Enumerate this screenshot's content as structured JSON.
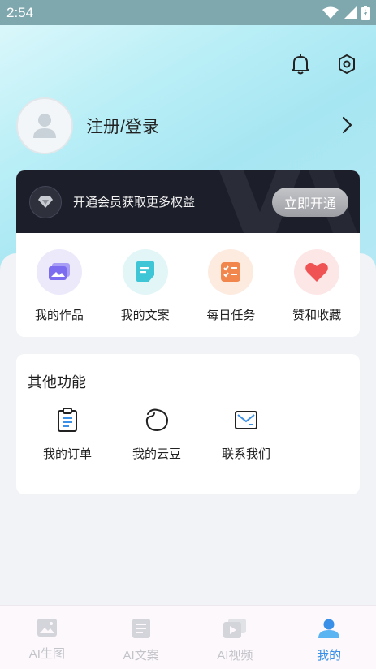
{
  "status_bar": {
    "time": "2:54"
  },
  "profile": {
    "login_label": "注册/登录"
  },
  "vip": {
    "text": "开通会员获取更多权益",
    "button_label": "立即开通"
  },
  "quick_actions": [
    {
      "label": "我的作品",
      "icon": "gallery-icon",
      "bg": "#ece9fb",
      "color": "#7b6cf0"
    },
    {
      "label": "我的文案",
      "icon": "document-icon",
      "bg": "#e2f6f8",
      "color": "#3ec6d6"
    },
    {
      "label": "每日任务",
      "icon": "task-list-icon",
      "bg": "#fdebe0",
      "color": "#f2874d"
    },
    {
      "label": "赞和收藏",
      "icon": "heart-icon",
      "bg": "#fde6e6",
      "color": "#f05353"
    }
  ],
  "other": {
    "title": "其他功能",
    "items": [
      {
        "label": "我的订单",
        "icon": "clipboard-icon"
      },
      {
        "label": "我的云豆",
        "icon": "bean-icon"
      },
      {
        "label": "联系我们",
        "icon": "mail-icon"
      }
    ]
  },
  "tabs": [
    {
      "label": "AI生图",
      "icon": "image-icon",
      "active": false
    },
    {
      "label": "AI文案",
      "icon": "document-icon",
      "active": false
    },
    {
      "label": "AI视频",
      "icon": "video-icon",
      "active": false
    },
    {
      "label": "我的",
      "icon": "person-icon",
      "active": true
    }
  ],
  "colors": {
    "accent": "#3a8fe6",
    "vip_bg": "#1c1e2a",
    "inactive_tab": "#c3c4c9"
  }
}
